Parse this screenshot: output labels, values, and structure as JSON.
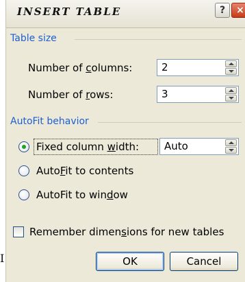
{
  "dialog": {
    "title": "INSERT TABLE",
    "help_icon": "?",
    "close_icon": "×"
  },
  "table_size": {
    "label": "Table size",
    "columns": {
      "label_pre": "Number of ",
      "label_key": "c",
      "label_post": "olumns:",
      "value": "2"
    },
    "rows": {
      "label_pre": "Number of ",
      "label_key": "r",
      "label_post": "ows:",
      "value": "3"
    }
  },
  "autofit": {
    "label": "AutoFit behavior",
    "fixed": {
      "label_pre": "Fixed column ",
      "label_key": "w",
      "label_post": "idth:",
      "value": "Auto",
      "selected": true
    },
    "contents": {
      "label_pre": "Auto",
      "label_key": "F",
      "label_post": "it to contents",
      "selected": false
    },
    "window": {
      "label_pre": "AutoFit to win",
      "label_key": "d",
      "label_post": "ow",
      "selected": false
    }
  },
  "remember": {
    "label_pre": "Remember dimen",
    "label_key": "s",
    "label_post": "ions for new tables",
    "checked": false
  },
  "buttons": {
    "ok": "OK",
    "cancel": "Cancel"
  },
  "colors": {
    "group_label": "#1c5fd4",
    "dialog_bg": "#ece9d8",
    "radio_selected": "#21a121"
  }
}
